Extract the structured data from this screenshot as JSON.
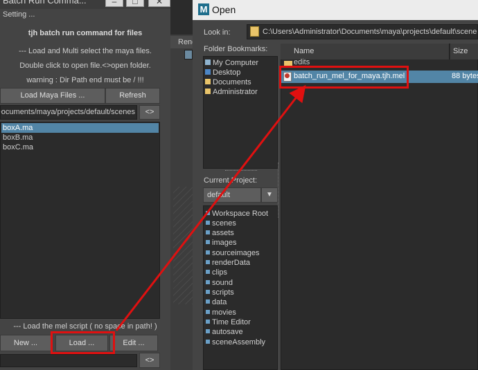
{
  "left_window": {
    "title": "Batch Run Comma...",
    "menu": "Setting ...",
    "tool_title": "tjh batch run command for files",
    "help_line1": "--- Load and Multi select the maya files.",
    "help_line2": "Double click to open file.<>open folder.",
    "warning": "warning : Dir Path end must be / !!!",
    "load_files_button": "Load  Maya  Files ...",
    "refresh_button": "Refresh",
    "path_value": "C:/Users/Administrator/Documents/maya/projects/default/scenes/",
    "toggle_button": "<>",
    "files": [
      {
        "name": "boxA.ma",
        "selected": true
      },
      {
        "name": "boxB.ma",
        "selected": false
      },
      {
        "name": "boxC.ma",
        "selected": false
      }
    ],
    "mel_label": "--- Load the mel script ( no space in path! )",
    "new_button": "New ...",
    "load_button": "Load ...",
    "edit_button": "Edit ...",
    "script_field_value": "",
    "script_toggle_button": "<>"
  },
  "background": {
    "tab_label": "Rend"
  },
  "open_dialog": {
    "title": "Open",
    "look_in_label": "Look in:",
    "look_in_path": "C:\\Users\\Administrator\\Documents\\maya\\projects\\default\\scenes",
    "bookmarks_label": "Folder Bookmarks:",
    "bookmarks": [
      "My Computer",
      "Desktop",
      "Documents",
      "Administrator"
    ],
    "current_project_label": "Current Project:",
    "current_project_value": "default",
    "workspace_items": [
      "Workspace Root",
      "scenes",
      "assets",
      "images",
      "sourceimages",
      "renderData",
      "clips",
      "sound",
      "scripts",
      "data",
      "movies",
      "Time Editor",
      "autosave",
      "sceneAssembly"
    ],
    "columns": {
      "name": "Name",
      "size": "Size"
    },
    "entries": [
      {
        "name": "edits",
        "size": "",
        "type": "folder"
      },
      {
        "name": "batch_run_mel_for_maya.tjh.mel",
        "size": "88 bytes",
        "type": "file",
        "selected": true
      }
    ]
  },
  "colors": {
    "highlight": "#e01010",
    "selection": "#5285a6",
    "panel": "#444444",
    "field": "#2b2b2b"
  }
}
